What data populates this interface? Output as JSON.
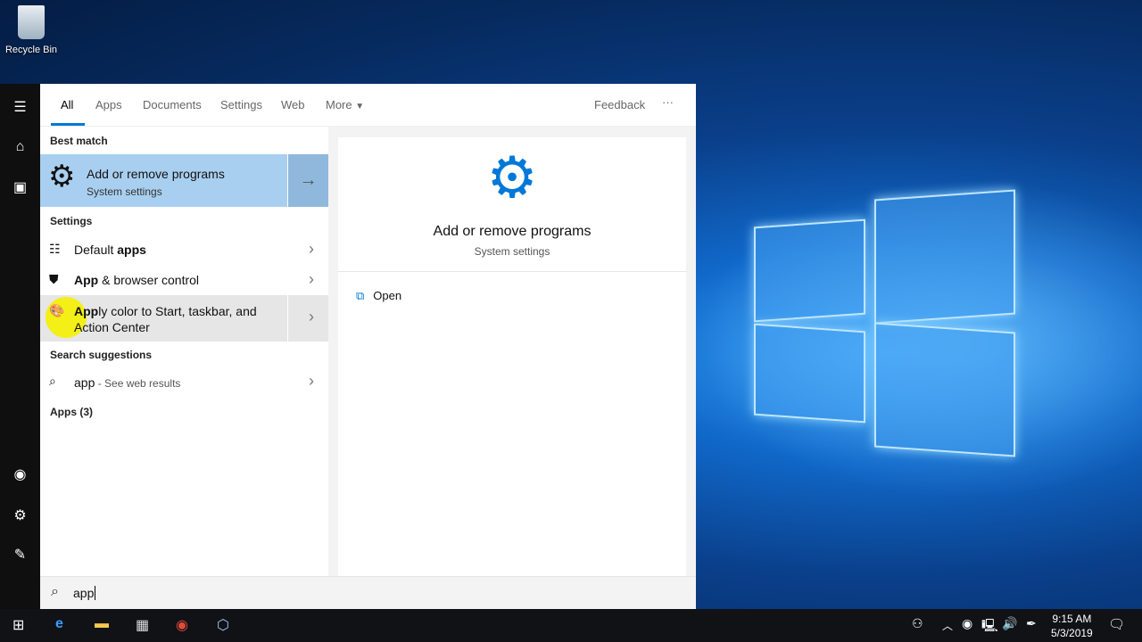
{
  "desktop": {
    "recycle_bin_label": "Recycle Bin"
  },
  "tabs": [
    {
      "label": "All"
    },
    {
      "label": "Apps"
    },
    {
      "label": "Documents"
    },
    {
      "label": "Settings"
    },
    {
      "label": "Web"
    },
    {
      "label": "More"
    }
  ],
  "feedback_label": "Feedback",
  "more_options_label": "···",
  "results": {
    "best_match_header": "Best match",
    "best_match": {
      "title": "Add or remove programs",
      "subtitle": "System settings",
      "icon": "gear-icon"
    },
    "settings_header": "Settings",
    "settings_items": [
      {
        "pre": "Default ",
        "bold": "apps",
        "post": "",
        "icon": "list-icon"
      },
      {
        "pre": "",
        "bold": "App",
        "post": " & browser control",
        "icon": "shield-icon"
      },
      {
        "pre": "",
        "bold": "App",
        "post": "ly color to Start, taskbar, and Action Center",
        "icon": "palette-icon"
      }
    ],
    "suggestions_header": "Search suggestions",
    "suggestion": {
      "query": "app",
      "hint": " - See web results"
    },
    "apps_header": "Apps (3)"
  },
  "preview": {
    "title": "Add or remove programs",
    "subtitle": "System settings",
    "open_label": "Open"
  },
  "search": {
    "value": "app"
  },
  "tray": {
    "time": "9:15 AM",
    "date": "5/3/2019"
  },
  "colors": {
    "accent": "#0078d7",
    "best_match_bg": "#a9cff0",
    "highlight_bg": "#e6e6e6"
  }
}
